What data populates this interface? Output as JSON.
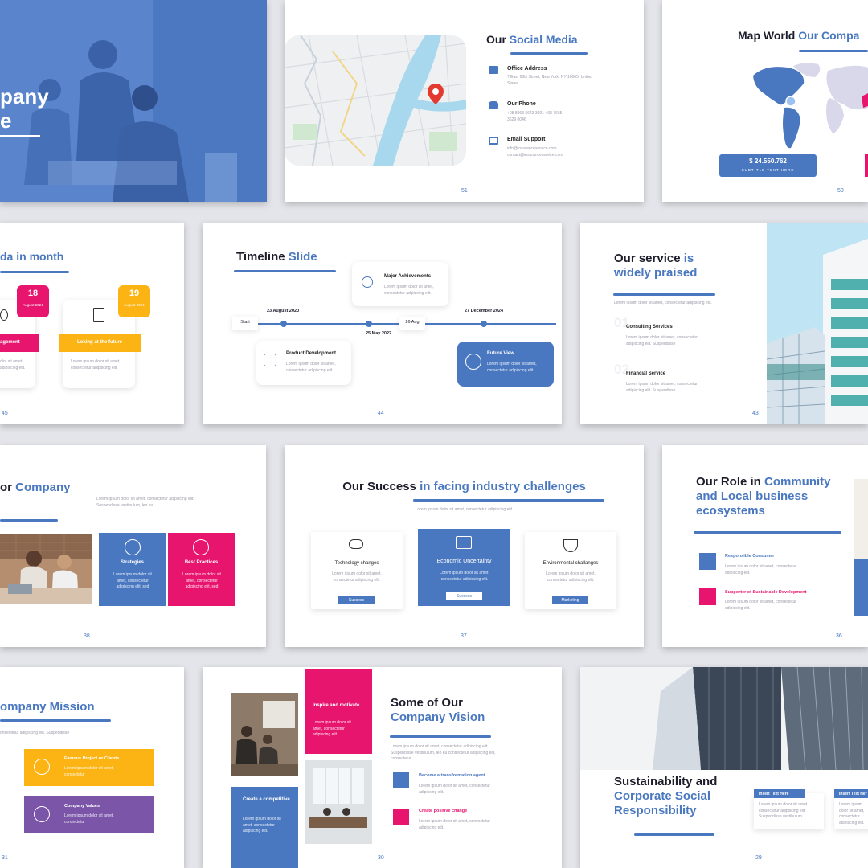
{
  "s1": {
    "title": "pany",
    "title2": "e"
  },
  "s2": {
    "title_a": "Our",
    "title_b": "Social Media",
    "office_label": "Office Address",
    "office_text": "7 East 68th Street, New York, NY 10065, United States",
    "phone_label": "Our Phone",
    "phone_text": "+08 8963 5643 3001 +08 7665 3629 0046",
    "email_label": "Email Support",
    "email_text": "info@insuranceservice.com contact@insuranceservice.com",
    "page": "51"
  },
  "s3": {
    "title_a": "Map World",
    "title_b": "Our Compa",
    "price": "$ 24.550.762",
    "subtitle": "SUBTITLE TEXT HERE",
    "page": "50"
  },
  "s4": {
    "title_a": "da",
    "title_b": "in month",
    "d1_day": "18",
    "d1_sub": "August 2024",
    "d2_day": "19",
    "d2_sub": "August 2024",
    "bar1": "agement",
    "bar2": "Loking at the future",
    "body": "Lorem ipsum dolor sit amet, consectetur adipiscing elit.",
    "body_short": "olor sit amet, adipiscing elit.",
    "page": "45"
  },
  "s5": {
    "title_a": "Timeline",
    "title_b": "Slide",
    "start": "Start",
    "d1": "23 August 2020",
    "d2": "25 May 2022",
    "d3": "26 Aug",
    "d4": "27 December 2024",
    "c1": "Major Achievements",
    "c2": "Product Development",
    "c3": "Future View",
    "body": "Lorem ipsum dolor sit amet, consectetur adipiscing elit.",
    "page": "44"
  },
  "s6": {
    "title_a": "Our service",
    "title_b": "is",
    "title_c": "widely praised",
    "intro": "Lorem ipsum dolor sit amet, consectetur adipiscing elit.",
    "n1": "01",
    "n2": "02",
    "i1": "Consulting Services",
    "i2": "Financial Service",
    "body": "Lorem ipsum dolor sit amet, consectetur adipiscing elit. Suspendisse",
    "page": "43"
  },
  "s7": {
    "title_a": "or",
    "title_b": "Company",
    "intro": "Lorem ipsum dolor sit amet, consectetur adipiscing elit. Suspendisse vestibulum, leo eu",
    "b1": "Strategies",
    "b2": "Best Practices",
    "body": "Lorem ipsum dolor sit amet, consectetur adipiscing elit, sed",
    "page": "38"
  },
  "s8": {
    "title_a": "Our Success",
    "title_b": "in facing industry challenges",
    "intro": "Lorem ipsum dolor sit amet, consectetur adipiscing elit.",
    "c1": "Technology changes",
    "c2": "Economic Uncertainty",
    "c3": "Environmental challanges",
    "body": "Lorem ipsum dolor sit amet, consectetur adipiscing elit.",
    "btn1": "Success",
    "btn2": "Success",
    "btn3": "Marketing",
    "page": "37"
  },
  "s9": {
    "title_a": "Our Role in",
    "title_b": "Community",
    "title_c": "and Local business",
    "title_d": "ecosystems",
    "i1": "Responsible Consumer",
    "i2": "Supporter of Sustainable Development",
    "body": "Lorem ipsum dolor sit amet, consectetur adipiscing elit.",
    "page": "36"
  },
  "s10": {
    "title": "ompany Mission",
    "intro": "onsectetur adipiscing elit. Suspendisse",
    "b1": "Famous Project or Clients",
    "b2": "Company Values",
    "body": "Lorem ipsum dolor sit amet, consectetur",
    "page": "31"
  },
  "s11": {
    "box1": "Inspire and motivate",
    "box2": "Create a competitive",
    "title_a": "Some of Our",
    "title_b": "Company Vision",
    "intro": "Lorem ipsum dolor sit amet, consectetur adipiscing elit. Suspendisse vestibulum, leo eu consectetur adipiscing elit, consectetur.",
    "i1": "Become a transformation agent",
    "i2": "Create positive change",
    "body": "Lorem ipsum dolor sit amet, consectetur adipiscing elit.",
    "page": "30"
  },
  "s12": {
    "title_a": "Sustainability and",
    "title_b": "Corporate Social",
    "title_c": "Responsibility",
    "tag": "Insert Text Here",
    "tag2": "Insert Text Her",
    "body": "Lorem ipsum dolor sit amet, consectetur adipiscing elit. Suspendisse vestibulum",
    "page": "29"
  },
  "colors": {
    "blue": "#4a78c0",
    "pink": "#e8156f",
    "yellow": "#fbb414",
    "purple": "#7a55a8"
  }
}
